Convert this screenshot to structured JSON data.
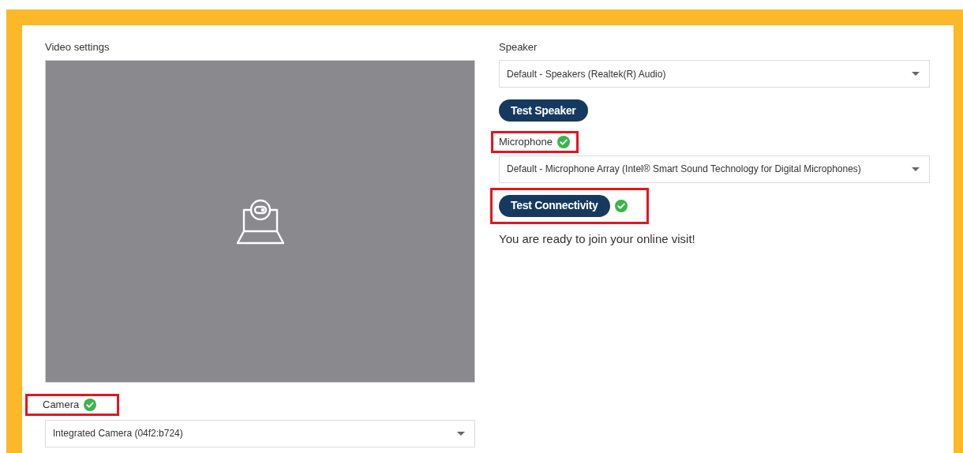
{
  "video": {
    "label": "Video settings"
  },
  "camera": {
    "label": "Camera",
    "verified": true,
    "highlighted": true,
    "value": "Integrated Camera (04f2:b724)"
  },
  "speaker": {
    "label": "Speaker",
    "value": "Default - Speakers (Realtek(R) Audio)",
    "button": "Test Speaker"
  },
  "microphone": {
    "label": "Microphone",
    "verified": true,
    "highlighted": true,
    "value": "Default - Microphone Array (Intel® Smart Sound Technology for Digital Microphones)"
  },
  "connectivity": {
    "button": "Test Connectivity",
    "verified": true,
    "highlighted": true
  },
  "message": "You are ready to join your online visit!"
}
